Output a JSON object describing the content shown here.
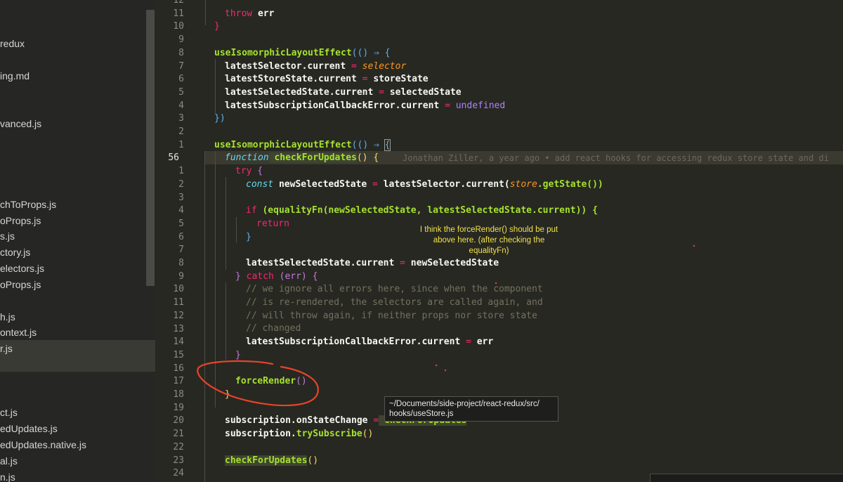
{
  "sidebar": {
    "files": [
      "redux",
      "ing.md",
      "vanced.js",
      "chToProps.js",
      "oProps.js",
      "s.js",
      "ctory.js",
      "electors.js",
      "oProps.js",
      "h.js",
      "ontext.js",
      "r.js",
      "ct.js",
      "edUpdates.js",
      "edUpdates.native.js",
      "al.js",
      "n.js"
    ],
    "selected_index": 11
  },
  "editor": {
    "line_numbers": [
      "12",
      "11",
      "10",
      "9",
      "8",
      "7",
      "6",
      "5",
      "4",
      "3",
      "2",
      "1",
      "56",
      "1",
      "2",
      "3",
      "4",
      "5",
      "6",
      "7",
      "8",
      "9",
      "10",
      "11",
      "12",
      "13",
      "14",
      "15",
      "16",
      "17",
      "18",
      "19",
      "20",
      "21",
      "22",
      "23",
      "24"
    ],
    "current_line_number": "56",
    "code": {
      "throw": "throw",
      "err": " err",
      "brace_close": "}",
      "uile1": "useIsomorphicLayoutEffect",
      "arrow_open": "(() ⇒ {",
      "ls_cur": "latestSelector.current ",
      "eq": "=",
      "selector": " selector",
      "lss_cur": "latestStoreState.current ",
      "storeState": " storeState",
      "lsel_cur": "latestSelectedState.current ",
      "selectedState": " selectedState",
      "lsce_cur": "latestSubscriptionCallbackError.current ",
      "undefined": " undefined",
      "close_paren": "})",
      "uile2": "useIsomorphicLayoutEffect",
      "arrow_open2": "(() ⇒ ",
      "bracket": "{",
      "function_kw": "function",
      "checkForUpdates": " checkForUpdates",
      "fn_parens": "() {",
      "try": "try",
      "try_brace": " {",
      "const": "const",
      "newSelectedState": " newSelectedState ",
      "ls_current_call": " latestSelector.current(",
      "store": "store",
      "getState": ".getState())",
      "if": "if",
      "if_cond": " (equalityFn(newSelectedState, latestSelectedState.current)) {",
      "return": "return",
      "inner_brace": "}",
      "assign_line": "latestSelectedState.current ",
      "newSelectedState2": " newSelectedState",
      "catch_close": "} ",
      "catch": "catch",
      "catch_rest": " (err) {",
      "c1": "// we ignore all errors here, since when the component",
      "c2": "// is re-rendered, the selectors are called again, and",
      "c3": "// will throw again, if neither props nor store state",
      "c4": "// changed",
      "lsce_assign": "latestSubscriptionCallbackError.current ",
      "err2": " err",
      "close_brace2": "}",
      "forceRender": "forceRender",
      "fr_parens": "()",
      "close_brace3": "}",
      "sub_onchange": "subscription.onStateChange ",
      "checkForUpdates_ref": " checkForUpdates",
      "sub_try": "subscription.",
      "trySubscribe": "trySubscribe",
      "try_parens": "()",
      "checkForUpdates_call": "checkForUpdates",
      "cfu_parens": "()"
    },
    "blame": "Jonathan Ziller, a year ago • add react hooks for accessing redux store state and di"
  },
  "annotation": {
    "note_lines": [
      "I think the forceRender() should be put",
      "above here. (after checking the",
      "equalityFn)"
    ],
    "color": "#f2e14a",
    "circle_color": "#e8432a"
  },
  "tooltip": {
    "line1": "~/Documents/side-project/react-redux/src/",
    "line2": "hooks/useStore.js"
  }
}
